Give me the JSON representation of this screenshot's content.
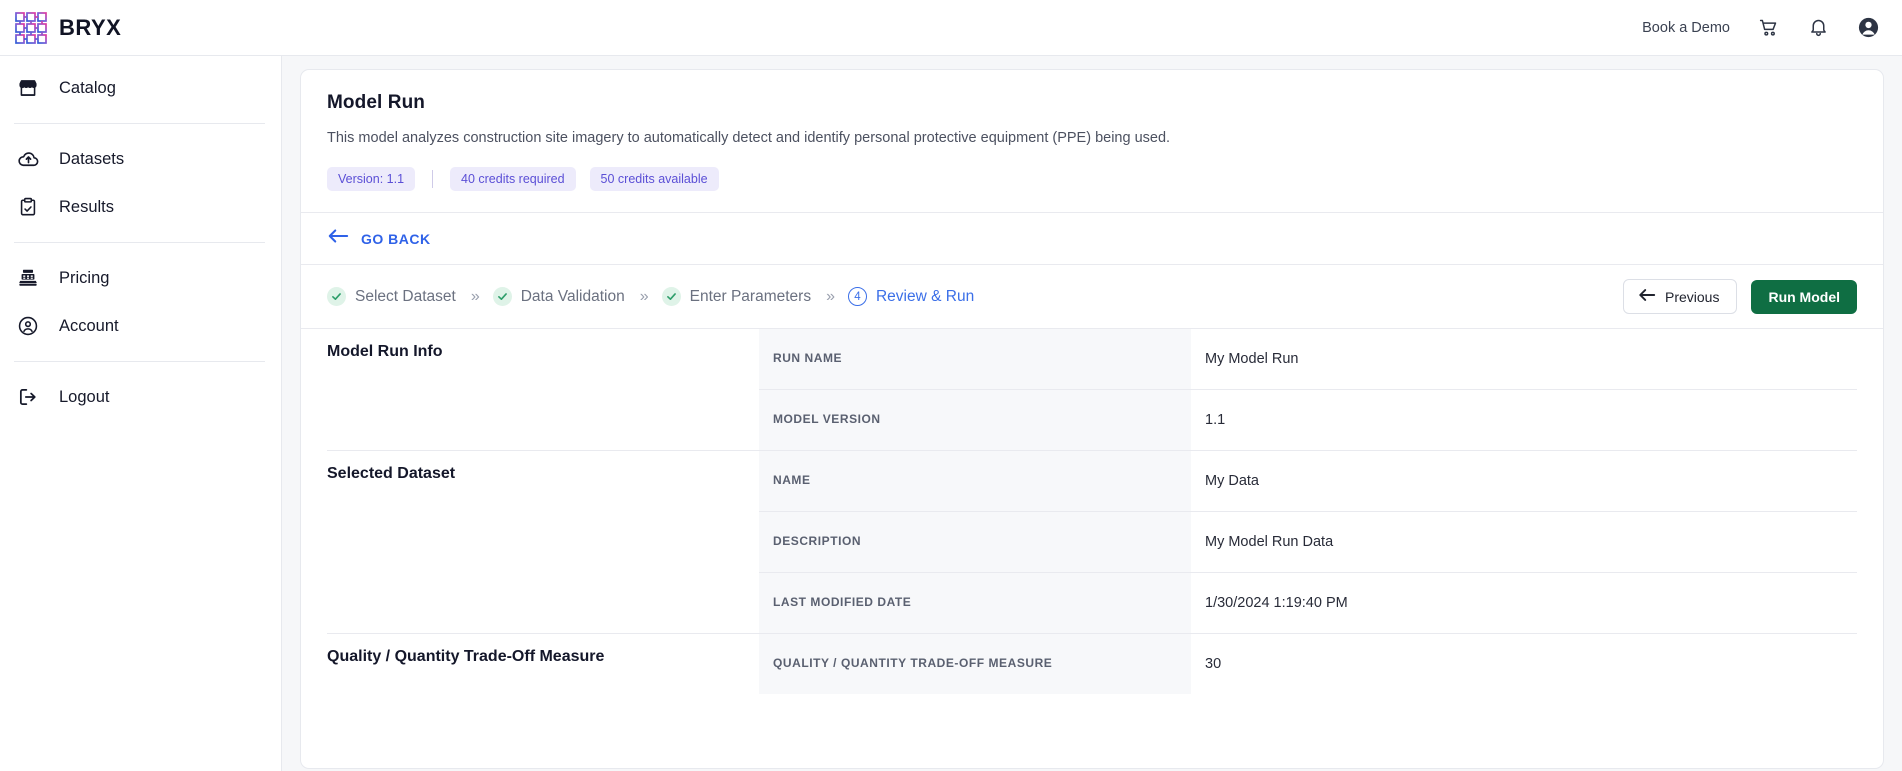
{
  "brand": {
    "name": "BRYX"
  },
  "topbar": {
    "book_demo": "Book a Demo",
    "cart_icon": "shopping-cart-icon",
    "bell_icon": "notification-bell-icon",
    "account_icon": "account-circle-icon"
  },
  "sidebar": {
    "groups": [
      {
        "items": [
          {
            "label": "Catalog",
            "icon": "storefront-icon"
          }
        ]
      },
      {
        "items": [
          {
            "label": "Datasets",
            "icon": "cloud-upload-icon"
          },
          {
            "label": "Results",
            "icon": "clipboard-check-icon"
          }
        ]
      },
      {
        "items": [
          {
            "label": "Pricing",
            "icon": "cash-register-icon"
          },
          {
            "label": "Account",
            "icon": "account-circle-outline-icon"
          }
        ]
      },
      {
        "items": [
          {
            "label": "Logout",
            "icon": "sign-out-icon"
          }
        ]
      }
    ]
  },
  "page": {
    "title": "Model Run",
    "description": "This model analyzes construction site imagery to automatically detect and identify personal protective equipment (PPE) being used.",
    "badges": [
      "Version: 1.1",
      "40 credits required",
      "50 credits available"
    ],
    "go_back": "GO BACK"
  },
  "stepper": {
    "steps": [
      {
        "label": "Select Dataset",
        "state": "done",
        "mark": "✓"
      },
      {
        "label": "Data Validation",
        "state": "done",
        "mark": "✓"
      },
      {
        "label": "Enter Parameters",
        "state": "done",
        "mark": "✓"
      },
      {
        "label": "Review & Run",
        "state": "current",
        "mark": "4"
      }
    ],
    "separator": "»",
    "previous_label": "Previous",
    "run_label": "Run Model"
  },
  "sections": [
    {
      "title": "Model Run Info",
      "rows": [
        {
          "label": "RUN NAME",
          "value": "My Model Run"
        },
        {
          "label": "MODEL VERSION",
          "value": "1.1"
        }
      ]
    },
    {
      "title": "Selected Dataset",
      "rows": [
        {
          "label": "NAME",
          "value": "My Data"
        },
        {
          "label": "DESCRIPTION",
          "value": "My Model Run Data"
        },
        {
          "label": "LAST MODIFIED DATE",
          "value": "1/30/2024 1:19:40 PM"
        }
      ]
    },
    {
      "title": "Quality / Quantity Trade-Off Measure",
      "rows": [
        {
          "label": "QUALITY / QUANTITY TRADE-OFF MEASURE",
          "value": "30"
        }
      ]
    }
  ],
  "colors": {
    "accent_blue": "#3b6fe8",
    "badge_bg": "#edebfb",
    "badge_text": "#5b4fd6",
    "run_green": "#0f6e43",
    "check_green": "#2e9e6b"
  }
}
